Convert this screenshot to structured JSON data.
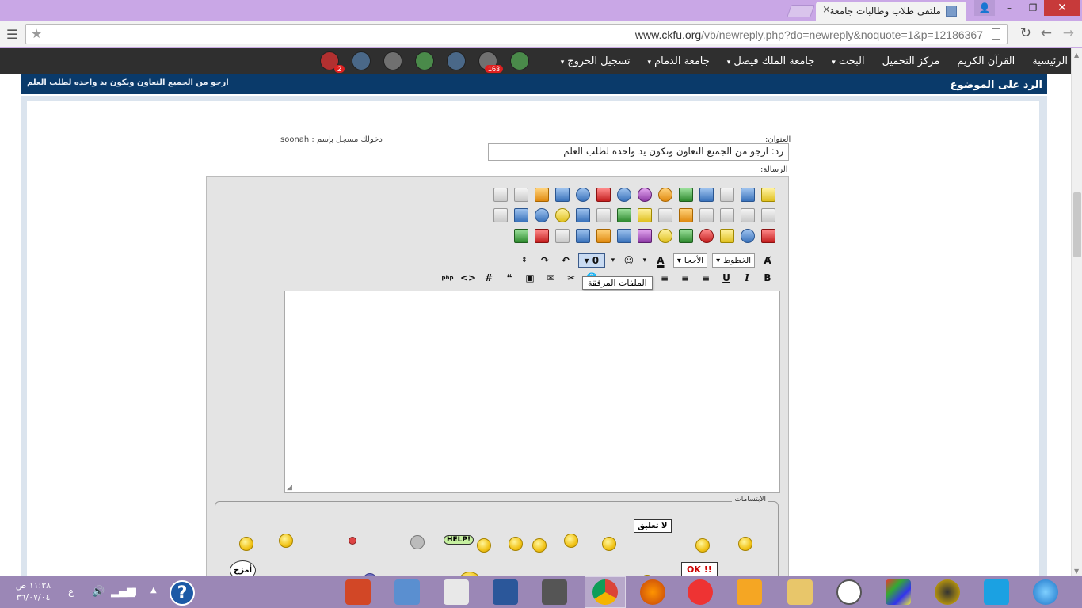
{
  "browser": {
    "tab_title": "ملتقى طلاب وطالبات جامعة",
    "tab_close": "×",
    "url_host": "www.ckfu.org",
    "url_path": "/vb/newreply.php?do=newreply&noquote=1&p=12186367",
    "win_min": "–",
    "win_max": "❐",
    "win_close": "✕"
  },
  "nav": {
    "items": [
      "الرئيسية",
      "القرآن الكريم",
      "مركز التحميل",
      "البحث",
      "جامعة الملك فيصل",
      "جامعة الدمام",
      "تسجيل الخروج"
    ],
    "caret": "▾",
    "badges": {
      "notifications": "163",
      "messages": "2"
    }
  },
  "form": {
    "header_title": "الرد على الموضوع",
    "header_subtitle": "ارجو من الجميع التعاون ونكون يد واحده لطلب العلم",
    "subject_label": "العنوان:",
    "logged_in": "دخولك مسجل بإسم : soonah",
    "subject_value": "رد: ارجو من الجميع التعاون ونكون يد واحده لطلب العلم",
    "message_label": "الرسالة:",
    "font_select": "الخطوط",
    "size_select": "الأحجا",
    "tooltip": "الملفات المرفقة",
    "smilies_legend": "الابتسامات",
    "sign_ok": "OK !!",
    "sign_no_comment": "لا تعليق",
    "sign_help": "HELP!",
    "sign_joke": "أمزح"
  },
  "taskbar": {
    "time": "١١:٣٨ ص",
    "date": "٣٦/٠٧/٠٤",
    "lang": "ع",
    "help": "?"
  },
  "colors": {
    "header_band": "#0a3a6a",
    "nav_bar": "#2f2f2f",
    "titlebar": "#c9a7e6",
    "taskbar": "#9b87b6"
  }
}
